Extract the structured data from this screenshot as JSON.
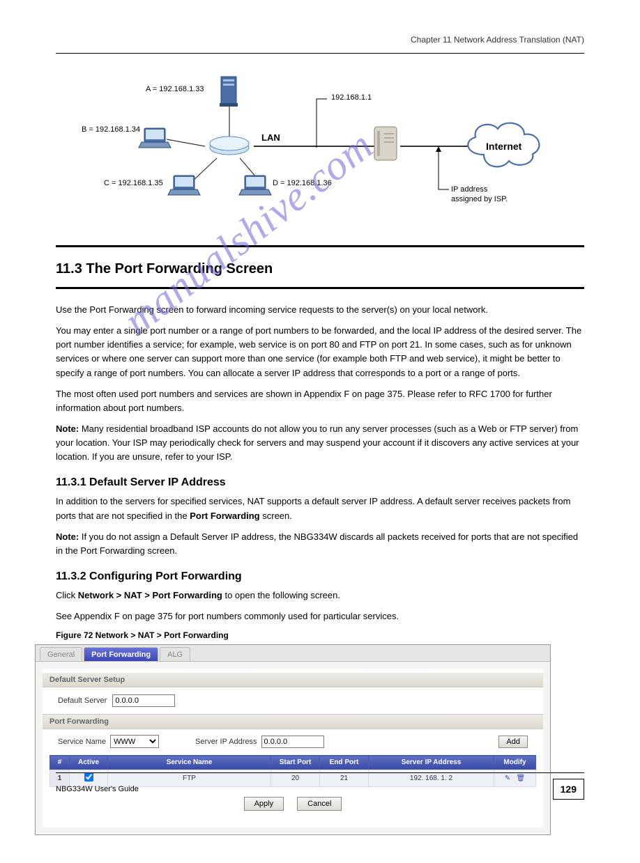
{
  "header": {
    "chapter_ref": "Chapter 11 Network Address Translation (NAT)"
  },
  "diagram": {
    "node_a": "A = 192.168.1.33",
    "node_b": "B = 192.168.1.34",
    "node_c": "C = 192.168.1.35",
    "node_d": "D = 192.168.1.36",
    "router_ip": "192.168.1.1",
    "lan_label": "LAN",
    "internet": "Internet",
    "isp_note1": "IP address",
    "isp_note2": "assigned by ISP."
  },
  "section": {
    "number": "11.3  The Port Forwarding Screen",
    "p1": "Use the Port Forwarding screen to forward incoming service requests to the server(s) on your local network.",
    "p2_a": "You may enter a single port number or a range of port numbers to be forwarded, and the local IP address of the desired server. The port number identifies a service; for example, web service is on port 80 and FTP on port 21. In some cases, such as for unknown services or where one server can support more than one service (for example both FTP and web service), it might be better to specify a range of port numbers. You can allocate a server IP address that corresponds to a port or a range of ports.",
    "p2_b": "The most often used port numbers and services are shown in Appendix F on page 375. Please refer to RFC 1700 for further information about port numbers.",
    "note_heading": "Note:",
    "note_body": " Many residential broadband ISP accounts do not allow you to run any server processes (such as a Web or FTP server) from your location. Your ISP may periodically check for servers and may suspend your account if it discovers any active services at your location. If you are unsure, refer to your ISP.",
    "sub_number": "11.3.1  Default Server IP Address",
    "sub_body_a": "In addition to the servers for specified services, NAT supports a default server IP address. A default server receives packets from ports that are not specified in the ",
    "sub_body_b": "Port Forwarding",
    "sub_body_c": " screen.",
    "sub_note_heading": "Note:",
    "sub_note_body": " If you do not assign a Default Server IP address, the NBG334W discards all packets received for ports that are not specified in the Port Forwarding screen.",
    "sub2_number": "11.3.2  Configuring Port Forwarding",
    "sub2_body_a": "Click ",
    "sub2_body_b": "Network > NAT > Port Forwarding",
    "sub2_body_c": " to open the following screen.",
    "sub2_body_d": "See Appendix F on page 375 for port numbers commonly used for particular services."
  },
  "figure": {
    "caption": "Figure 72   Network > NAT > Port Forwarding"
  },
  "ui": {
    "tabs": {
      "general": "General",
      "portfwd": "Port Forwarding",
      "alg": "ALG"
    },
    "group1": "Default Server Setup",
    "default_server_label": "Default Server",
    "default_server_value": "0.0.0.0",
    "group2": "Port Forwarding",
    "service_name_label": "Service Name",
    "service_name_value": "WWW",
    "server_ip_label": "Server IP Address",
    "server_ip_value": "0.0.0.0",
    "add_btn": "Add",
    "cols": {
      "num": "#",
      "active": "Active",
      "name": "Service Name",
      "start": "Start Port",
      "end": "End Port",
      "ip": "Server IP Address",
      "modify": "Modify"
    },
    "row1": {
      "num": "1",
      "active": true,
      "name": "FTP",
      "start": "20",
      "end": "21",
      "ip": "192. 168. 1. 2"
    },
    "apply_btn": "Apply",
    "cancel_btn": "Cancel"
  },
  "footer": {
    "guide": "NBG334W User's Guide",
    "page": "129"
  },
  "watermark": "manualshive.com"
}
